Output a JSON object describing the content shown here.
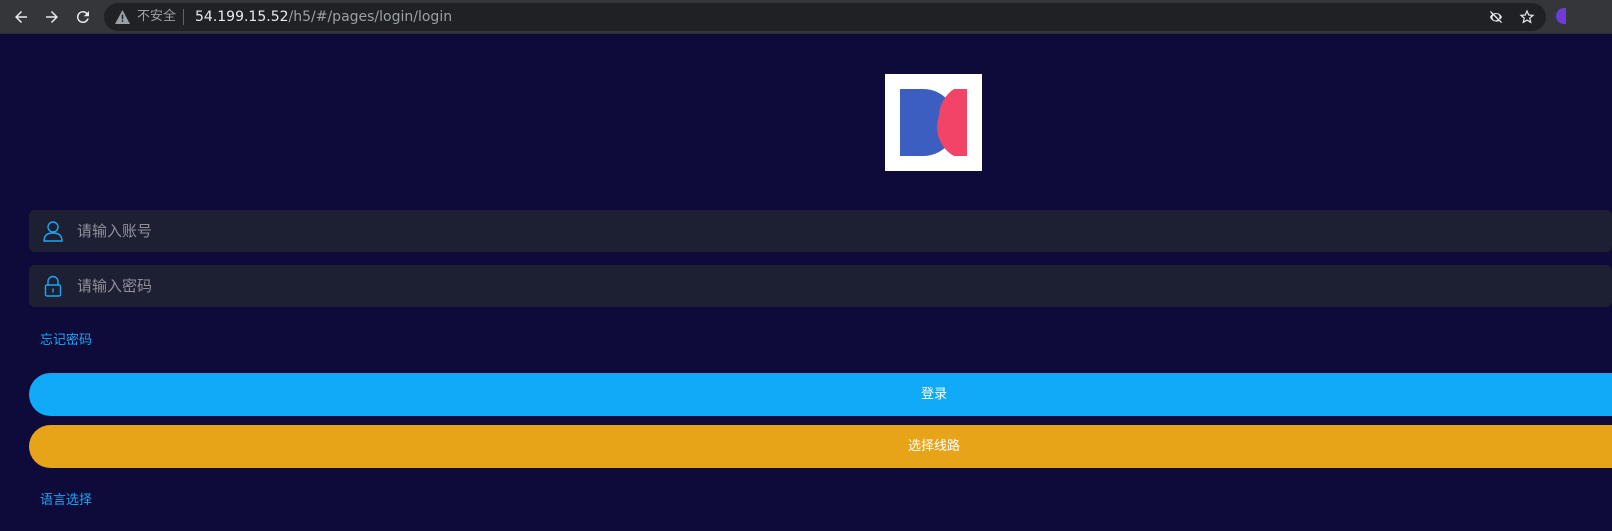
{
  "browser": {
    "security_label": "不安全",
    "url_host": "54.199.15.52",
    "url_path": "/h5/#/pages/login/login"
  },
  "login": {
    "account_placeholder": "请输入账号",
    "password_placeholder": "请输入密码",
    "forgot_password": "忘记密码",
    "login_button": "登录",
    "select_route_button": "选择线路",
    "language_select": "语言选择"
  },
  "colors": {
    "background": "#0e0b3a",
    "field_bg": "#1d2033",
    "accent_link": "#1aa7f5",
    "login_button": "#10aaf9",
    "route_button": "#e8a419",
    "logo_blue": "#3b5ec0",
    "logo_red": "#f24466"
  },
  "icons": {
    "back": "arrow-left-icon",
    "forward": "arrow-right-icon",
    "reload": "reload-icon",
    "warning": "warning-triangle-icon",
    "eye_off": "eye-off-icon",
    "bookmark": "star-icon",
    "user": "user-icon",
    "lock": "lock-icon"
  }
}
